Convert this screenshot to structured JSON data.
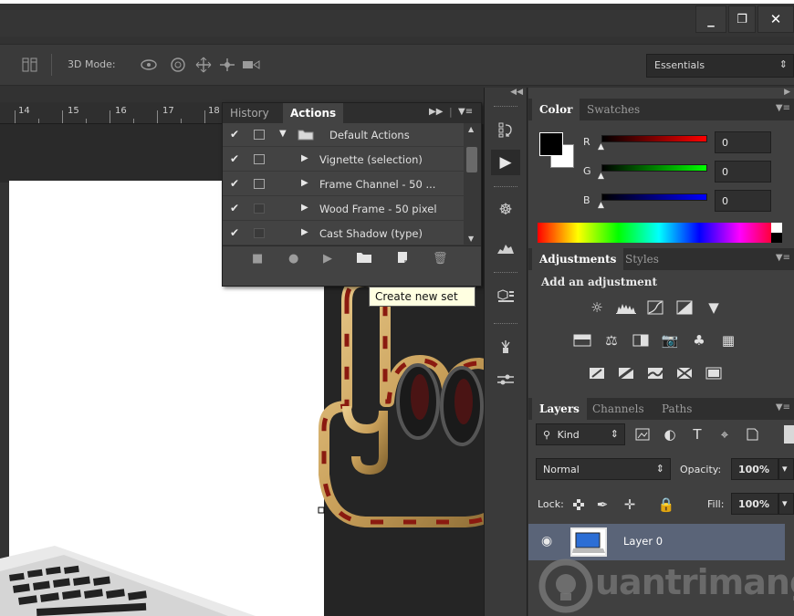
{
  "window": {
    "minimize": "_",
    "restore": "❐",
    "close": "✕"
  },
  "options_bar": {
    "mode_label": "3D Mode:",
    "workspace": "Essentials"
  },
  "ruler": {
    "ticks": [
      "14",
      "15",
      "16",
      "17",
      "18"
    ]
  },
  "actions_panel": {
    "tabs": [
      "History",
      "Actions"
    ],
    "active_tab": "Actions",
    "rows": [
      {
        "check": "✔",
        "name": "Default Actions",
        "kind": "set"
      },
      {
        "check": "✔",
        "name": "Vignette (selection)",
        "kind": "action"
      },
      {
        "check": "✔",
        "name": "Frame Channel - 50 ...",
        "kind": "action"
      },
      {
        "check": "✔",
        "name": "Wood Frame - 50 pixel",
        "kind": "action"
      },
      {
        "check": "✔",
        "name": "Cast Shadow (type)",
        "kind": "action"
      }
    ],
    "footer_icons": [
      "stop-icon",
      "record-icon",
      "play-icon",
      "new-set-icon",
      "new-action-icon",
      "trash-icon"
    ]
  },
  "tooltip": {
    "text": "Create new set"
  },
  "color_panel": {
    "tabs": [
      "Color",
      "Swatches"
    ],
    "channels": [
      {
        "letter": "R",
        "value": "0",
        "color": "#ff0000"
      },
      {
        "letter": "G",
        "value": "0",
        "color": "#00ff00"
      },
      {
        "letter": "B",
        "value": "0",
        "color": "#0000ff"
      }
    ]
  },
  "adjustments_panel": {
    "tabs": [
      "Adjustments",
      "Styles"
    ],
    "heading": "Add an adjustment"
  },
  "layers_panel": {
    "tabs": [
      "Layers",
      "Channels",
      "Paths"
    ],
    "filter": "Kind",
    "blend_mode": "Normal",
    "opacity_label": "Opacity:",
    "opacity_value": "100%",
    "lock_label": "Lock:",
    "fill_label": "Fill:",
    "fill_value": "100%",
    "layers": [
      {
        "name": "Layer 0",
        "visible": true
      }
    ]
  },
  "watermark": {
    "text": "uantrimang"
  }
}
